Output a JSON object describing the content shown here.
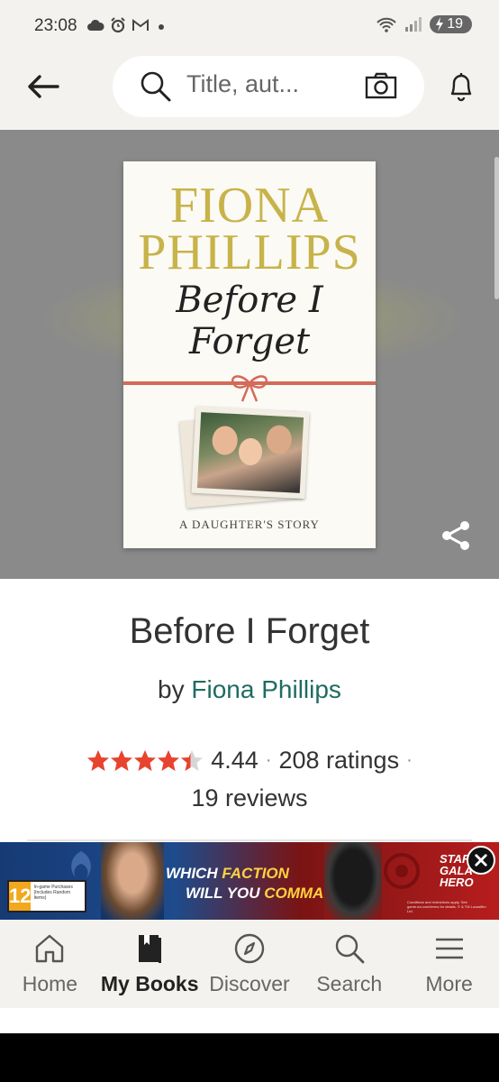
{
  "status_bar": {
    "time": "23:08",
    "battery": "19"
  },
  "search": {
    "placeholder": "Title, aut..."
  },
  "cover": {
    "author": "FIONA PHILLIPS",
    "title_line1": "Before I",
    "title_line2": "Forget",
    "subtitle": "A DAUGHTER'S STORY"
  },
  "book": {
    "title": "Before I Forget",
    "by": "by",
    "author": "Fiona Phillips",
    "rating": "4.44",
    "ratings_text": "208 ratings",
    "reviews_text": "19 reviews",
    "stars": 4.44
  },
  "ad": {
    "age_rating": "12",
    "age_note": "In-game Purchases (Includes Random Items)",
    "headline_pre": "WHICH ",
    "headline_em1": "FACTION",
    "headline_mid": "WILL YOU ",
    "headline_em2": "COMMAND?",
    "logo_line1": "STAR",
    "logo_line2": "GALA",
    "logo_line3": "HERO",
    "fine_print": "Conditions and restrictions apply. See game.ea.com/terms for details. © & TM Lucasfilm Ltd."
  },
  "nav": {
    "items": [
      {
        "label": "Home",
        "icon": "home-icon"
      },
      {
        "label": "My Books",
        "icon": "my-books-icon"
      },
      {
        "label": "Discover",
        "icon": "compass-icon"
      },
      {
        "label": "Search",
        "icon": "search-icon"
      },
      {
        "label": "More",
        "icon": "menu-icon"
      }
    ],
    "active": "My Books"
  },
  "colors": {
    "star": "#e8432e",
    "author_link": "#1f6b62",
    "cover_author": "#c8b34a",
    "ribbon": "#d46a5a"
  }
}
